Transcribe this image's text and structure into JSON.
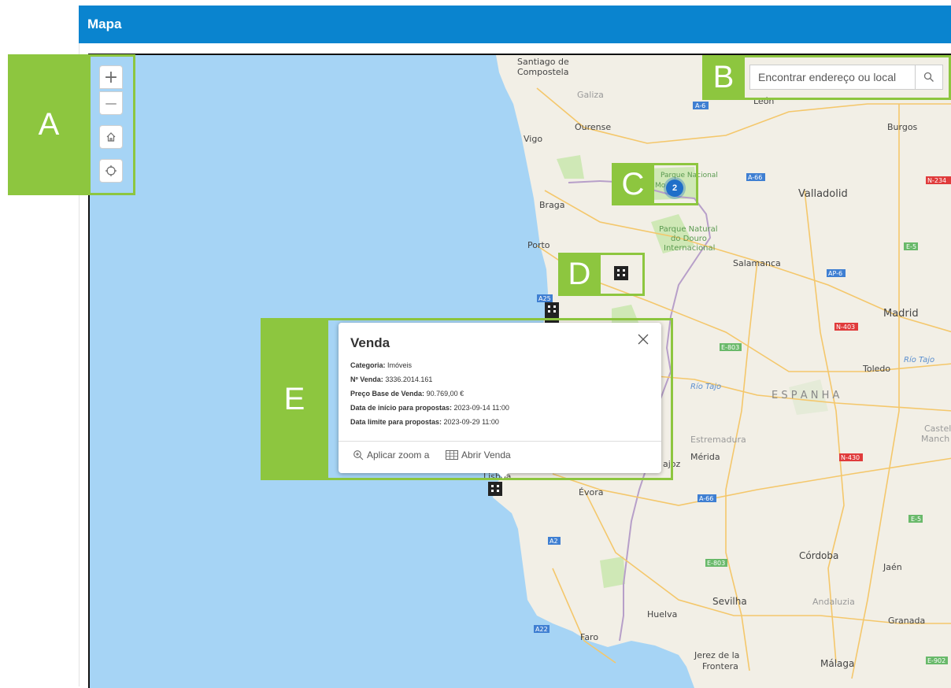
{
  "header": {
    "title": "Mapa"
  },
  "callouts": {
    "a": "A",
    "b": "B",
    "c": "C",
    "d": "D",
    "e": "E"
  },
  "controls": {
    "zoom_in": "+",
    "zoom_out": "—",
    "home_icon": "home-icon",
    "locate_icon": "locate-icon"
  },
  "search": {
    "placeholder": "Encontrar endereço ou local"
  },
  "cluster": {
    "count": "2"
  },
  "map": {
    "places": {
      "santiago1": "Santiago de",
      "santiago2": "Compostela",
      "galiza": "Galiza",
      "leon": "León",
      "ourense": "Ourense",
      "burgos": "Burgos",
      "vigo": "Vigo",
      "pn1": "Parque Nacional",
      "pn2": "Mo",
      "valladolid": "Valladolid",
      "braga": "Braga",
      "douro1": "Parque Natural",
      "douro2": "do Douro",
      "douro3": "Internacional",
      "porto": "Porto",
      "salamanca": "Salamanca",
      "madrid": "Madrid",
      "toledo": "Toledo",
      "rio_tajo1": "Río Tajo",
      "rio_tajo2": "Río Tajo",
      "espanha": "E S P A N H A",
      "castela1": "Castela",
      "castela2": "Manch",
      "estremadura": "Estremadura",
      "merida": "Mérida",
      "ajoz": "ajoz",
      "lisboa": "Lisboa",
      "evora": "Évora",
      "cordoba": "Córdoba",
      "jaen": "Jaén",
      "sevilha": "Sevilha",
      "andaluzia": "Andaluzia",
      "huelva": "Huelva",
      "granada": "Granada",
      "faro": "Faro",
      "jerez1": "Jerez de la",
      "jerez2": "Frontera",
      "malaga": "Málaga"
    },
    "roads": {
      "a6a": "A-6",
      "a66a": "A-66",
      "n234": "N-234",
      "e5": "E-5",
      "ap6": "AP-6",
      "a25": "A25",
      "n403": "N-403",
      "e803a": "E-803",
      "n430": "N-430",
      "a66b": "A-66",
      "e5b": "E-5",
      "a2": "A2",
      "e803b": "E-803",
      "a22": "A22",
      "e902": "E-902"
    }
  },
  "popup": {
    "title": "Venda",
    "rows": [
      {
        "label": "Categoria:",
        "value": "Imóveis"
      },
      {
        "label": "Nº Venda:",
        "value": "3336.2014.161"
      },
      {
        "label": "Preço Base de Venda:",
        "value": "90.769,00 €"
      },
      {
        "label": "Data de início para propostas:",
        "value": "2023-09-14 11:00"
      },
      {
        "label": "Data limite para propostas:",
        "value": "2023-09-29 11:00"
      }
    ],
    "zoom_action": "Aplicar zoom a",
    "open_action": "Abrir Venda"
  },
  "colors": {
    "header": "#0a84cf",
    "callout": "#8dc63f",
    "sea": "#a6d4f5",
    "land": "#f2efe6",
    "cluster": "#1f6fc9"
  }
}
